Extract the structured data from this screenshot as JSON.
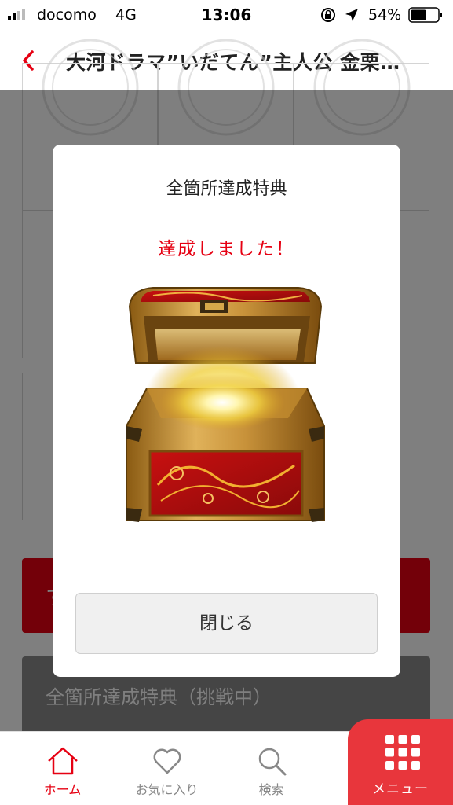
{
  "status_bar": {
    "carrier": "docomo",
    "network": "4G",
    "time": "13:06",
    "battery": "54%"
  },
  "header": {
    "title": "大河ドラマ”いだてん”主人公 金栗…"
  },
  "background": {
    "red_button_text": "す",
    "gray_button_text": "全箇所達成特典（挑戦中）"
  },
  "modal": {
    "title": "全箇所達成特典",
    "message": "達成しました！",
    "close_label": "閉じる"
  },
  "tabs": [
    {
      "label": "ホーム",
      "icon": "home-icon",
      "active": true
    },
    {
      "label": "お気に入り",
      "icon": "heart-icon",
      "active": false
    },
    {
      "label": "検索",
      "icon": "search-icon",
      "active": false
    },
    {
      "label": "メニュー",
      "icon": "menu-grid-icon",
      "active": false
    }
  ],
  "colors": {
    "accent": "#e60012",
    "menu_bg": "#e8363c"
  }
}
